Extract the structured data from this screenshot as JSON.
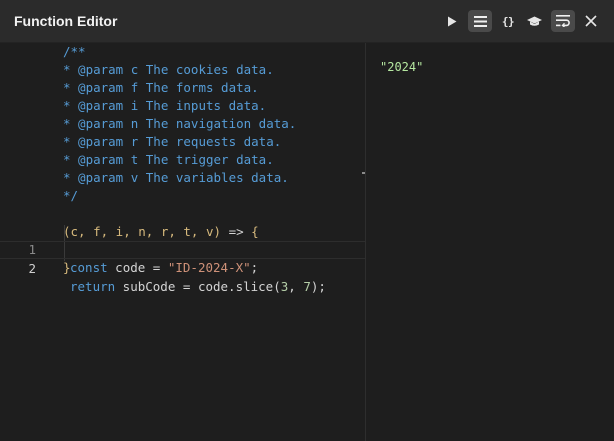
{
  "header": {
    "title": "Function Editor",
    "toolbar": {
      "run_icon": "play-icon",
      "list_icon": "list-icon",
      "braces_label": "{}",
      "hat_icon": "graduation-cap-icon",
      "wrap_icon": "wrap-text-icon",
      "close_icon": "close-icon"
    }
  },
  "editor": {
    "comment": [
      "/**",
      "* @param c The cookies data.",
      "* @param f The forms data.",
      "* @param i The inputs data.",
      "* @param n The navigation data.",
      "* @param r The requests data.",
      "* @param t The trigger data.",
      "* @param v The variables data.",
      "*/"
    ],
    "signature": {
      "params": "(c, f, i, n, r, t, v)",
      "arrow": " => ",
      "open": "{"
    },
    "lines": [
      {
        "number": "1",
        "kw": "const",
        "rest": " code = ",
        "str": "\"ID-2024-X\"",
        "end": ";"
      },
      {
        "number": "2",
        "kw": "return",
        "rest": " subCode = code.slice(",
        "n1": "3",
        "sep": ", ",
        "n2": "7",
        "end": ");"
      }
    ],
    "close": "}"
  },
  "output": {
    "result": "\"2024\""
  }
}
